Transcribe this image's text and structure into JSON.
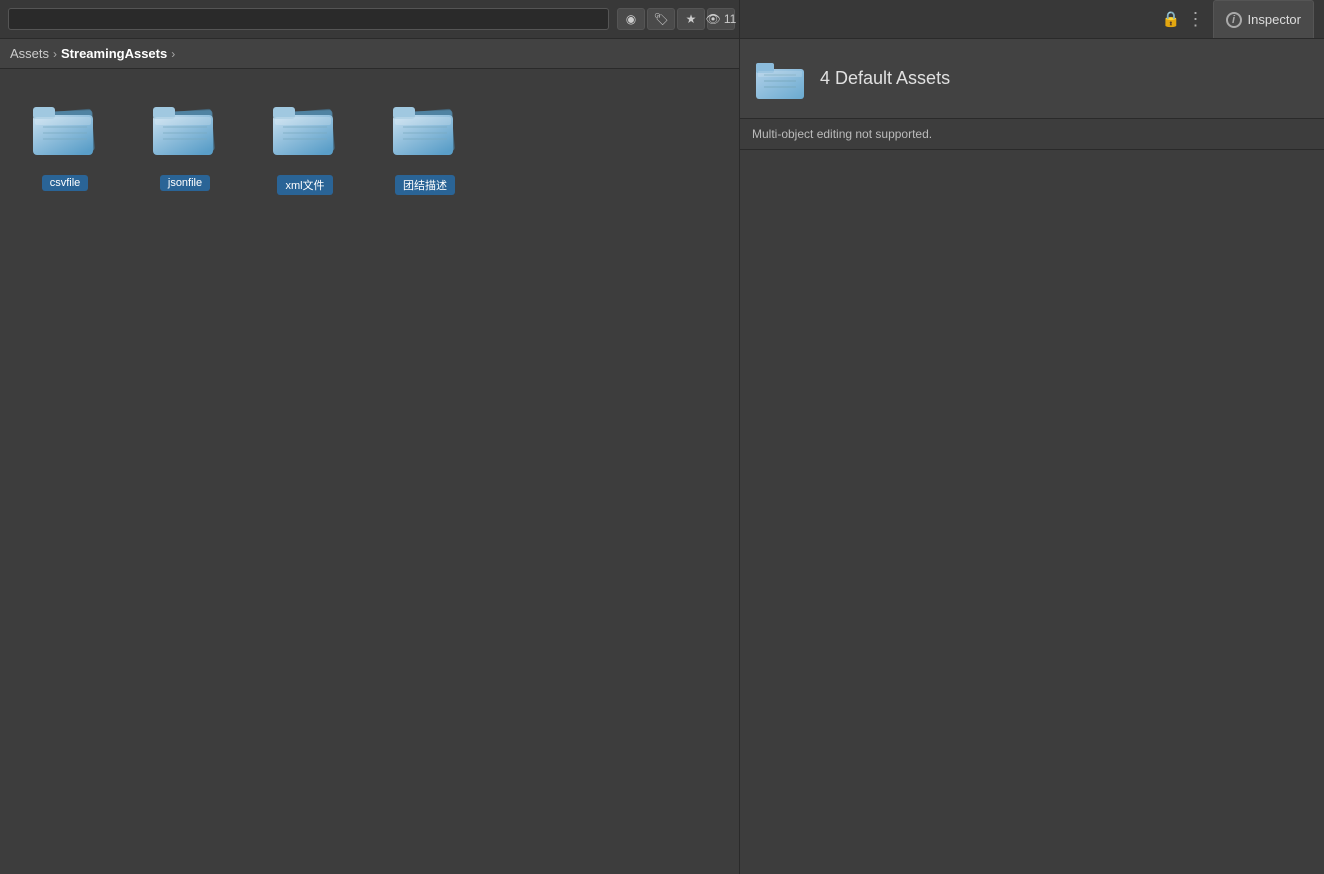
{
  "topbar": {
    "lock_icon": "🔒",
    "more_icon": "⋮",
    "toolbar": {
      "filter_icon": "◉",
      "tag_icon": "🏷",
      "star_icon": "★",
      "eye_label": "11"
    }
  },
  "inspector_tab": {
    "label": "Inspector",
    "info_icon": "i"
  },
  "breadcrumb": {
    "root": "Assets",
    "separator": "›",
    "current": "StreamingAssets",
    "arrow": "›"
  },
  "assets": [
    {
      "id": 1,
      "name": "csvfile"
    },
    {
      "id": 2,
      "name": "jsonfile"
    },
    {
      "id": 3,
      "name": "xml文件"
    },
    {
      "id": 4,
      "name": "团结描述"
    }
  ],
  "inspector": {
    "asset_count_label": "4 Default Assets",
    "multi_edit_msg": "Multi-object editing not supported."
  }
}
